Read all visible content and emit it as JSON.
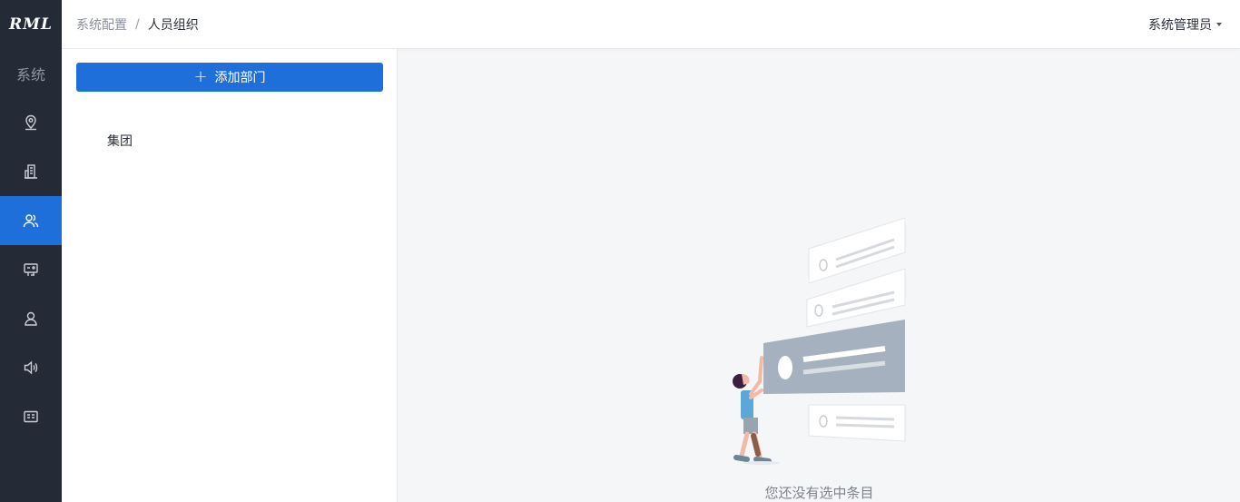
{
  "app": {
    "logo_text": "RML"
  },
  "rail": {
    "section_label": "系统",
    "items": [
      {
        "name": "location",
        "icon": "location-pin-icon",
        "active": false
      },
      {
        "name": "building",
        "icon": "building-icon",
        "active": false
      },
      {
        "name": "people",
        "icon": "users-icon",
        "active": true
      },
      {
        "name": "network",
        "icon": "network-icon",
        "active": false
      },
      {
        "name": "person",
        "icon": "person-icon",
        "active": false
      },
      {
        "name": "speaker",
        "icon": "speaker-icon",
        "active": false
      },
      {
        "name": "card",
        "icon": "id-card-icon",
        "active": false
      }
    ]
  },
  "header": {
    "breadcrumb_parent": "系统配置",
    "breadcrumb_sep": "/",
    "breadcrumb_current": "人员组织",
    "user_label": "系统管理员"
  },
  "panel": {
    "add_button_label": "添加部门",
    "tree": [
      {
        "label": "集团"
      }
    ]
  },
  "main": {
    "empty_text": "您还没有选中条目"
  },
  "colors": {
    "rail_bg": "#252b36",
    "accent": "#1f6fdb",
    "main_bg": "#f5f6f8"
  }
}
